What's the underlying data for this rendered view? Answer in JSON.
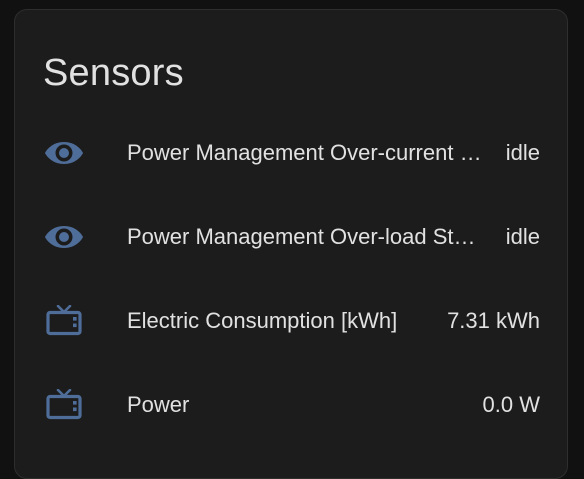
{
  "card": {
    "title": "Sensors"
  },
  "colors": {
    "icon": "#4f6d99",
    "text": "#e1e1e1",
    "card_bg": "#1c1c1c",
    "page_bg": "#111111"
  },
  "entities": [
    {
      "icon": "eye-icon",
      "name": "Power Management Over-current Status",
      "state": "idle"
    },
    {
      "icon": "eye-icon",
      "name": "Power Management Over-load Status",
      "state": "idle"
    },
    {
      "icon": "television-icon",
      "name": "Electric Consumption [kWh]",
      "state": "7.31 kWh"
    },
    {
      "icon": "television-icon",
      "name": "Power",
      "state": "0.0 W"
    }
  ]
}
